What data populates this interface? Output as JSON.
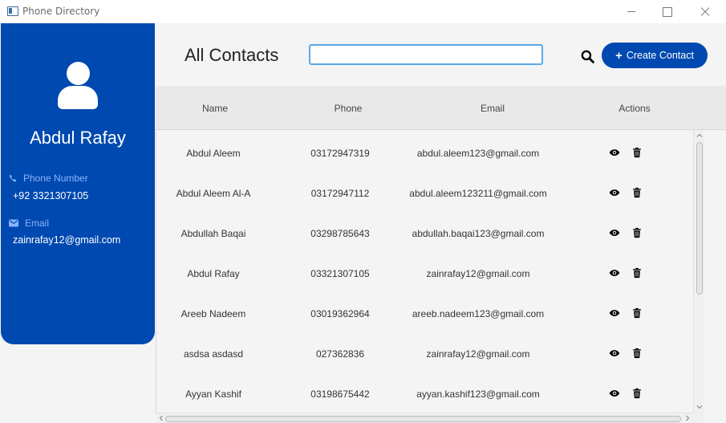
{
  "window": {
    "title": "Phone Directory"
  },
  "profile": {
    "name": "Abdul Rafay",
    "phone_label": "Phone Number",
    "phone": "+92 3321307105",
    "email_label": "Email",
    "email": "zainrafay12@gmail.com"
  },
  "header": {
    "title": "All Contacts",
    "search_value": "",
    "search_placeholder": "",
    "create_label": "Create Contact"
  },
  "table": {
    "columns": [
      "Name",
      "Phone",
      "Email",
      "Actions"
    ],
    "rows": [
      {
        "name": "Abdul Aleem",
        "phone": "03172947319",
        "email": "abdul.aleem123@gmail.com"
      },
      {
        "name": "Abdul Aleem Al-A",
        "phone": "03172947112",
        "email": "abdul.aleem123211@gmail.com"
      },
      {
        "name": "Abdullah Baqai",
        "phone": "03298785643",
        "email": "abdullah.baqai123@gmail.com"
      },
      {
        "name": "Abdul Rafay",
        "phone": "03321307105",
        "email": "zainrafay12@gmail.com"
      },
      {
        "name": "Areeb Nadeem",
        "phone": "03019362964",
        "email": "areeb.nadeem123@gmail.com"
      },
      {
        "name": "asdsa asdasd",
        "phone": "027362836",
        "email": "zainrafay12@gmail.com"
      },
      {
        "name": "Ayyan Kashif",
        "phone": "03198675442",
        "email": "ayyan.kashif123@gmail.com"
      }
    ],
    "actions": {
      "view_icon": "eye-icon",
      "delete_icon": "trash-icon"
    }
  },
  "colors": {
    "accent": "#0049b0",
    "search_border": "#5aa9e6",
    "label_blue": "#8ab4ff"
  }
}
